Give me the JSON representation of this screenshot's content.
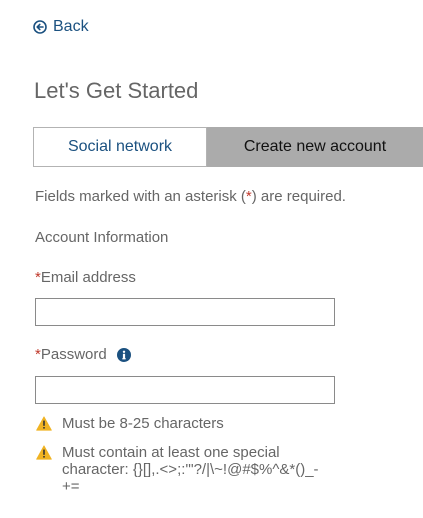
{
  "back": {
    "label": "Back",
    "icon": "back-circle-arrow-icon"
  },
  "title": "Let's Get Started",
  "tabs": [
    {
      "label": "Social network",
      "selected": false
    },
    {
      "label": "Create new account",
      "selected": true
    }
  ],
  "required_note": {
    "before": "Fields marked with an asterisk (",
    "star": "*",
    "after": ") are required."
  },
  "section_label": "Account Information",
  "fields": {
    "email": {
      "star": "*",
      "label": "Email address",
      "value": ""
    },
    "password": {
      "star": "*",
      "label": "Password",
      "value": "",
      "info_icon": "info-icon"
    }
  },
  "password_rules": [
    {
      "icon": "warning-icon",
      "text": "Must be 8-25 characters"
    },
    {
      "icon": "warning-icon",
      "text": "Must contain at least one special character: {}[],.<>;:'\"?/|\\~!@#$%^&*()_-+="
    }
  ],
  "colors": {
    "link": "#1b5180",
    "required_star": "#c0392b",
    "warning": "#f0b323",
    "selected_tab_bg": "#ababab"
  }
}
